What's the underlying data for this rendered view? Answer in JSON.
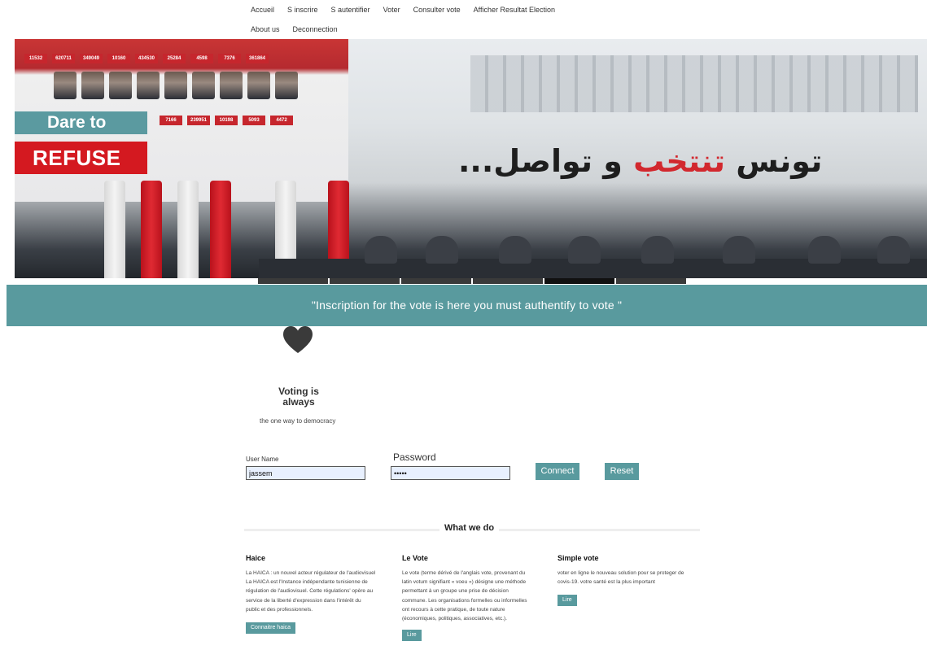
{
  "nav": {
    "row1": [
      "Accueil",
      "S inscrire",
      "S autentifier",
      "Voter",
      "Consulter vote",
      "Afficher Resultat Election"
    ],
    "row2": [
      "About us",
      "Deconnection"
    ]
  },
  "hero": {
    "dare": "Dare to",
    "refuse": "REFUSE",
    "arabic_black_left": "تونس ",
    "arabic_red": "تنتخب",
    "arabic_black_right": " و تواصل...",
    "vote_counts_top": [
      "11532",
      "620711",
      "349049",
      "10160",
      "434530",
      "25284",
      "4598",
      "7376",
      "361864"
    ],
    "vote_counts_bottom": [
      "7166",
      "239951",
      "10198",
      "5093",
      "4472"
    ]
  },
  "slider": {
    "count": 6,
    "active_index": 4
  },
  "banner": {
    "text": "\"Inscription for the vote is here you must authentify to vote \""
  },
  "tagline": {
    "title_line1": "Voting is",
    "title_line2": "always",
    "subtitle": "the one way to democracy"
  },
  "login": {
    "username_label": "User Name",
    "username_value": "jassem",
    "password_label": "Password",
    "password_value": "•••••",
    "connect_label": "Connect",
    "reset_label": "Reset"
  },
  "what_we_do": {
    "title": "What we do",
    "columns": [
      {
        "title": "Haice",
        "text": "La HAICA : un nouvel acteur régulateur de l'audiovisuel La HAICA est l'Instance indépendante tunisienne de régulation de l'audiovisuel. Cette régulations' opère au service de la liberté d'expression dans l'intérêt du public et des professionnels.",
        "button": "Connaitre haica"
      },
      {
        "title": "Le Vote",
        "text": "Le vote (terme dérivé de l'anglais vote, provenant du latin votum signifiant « voeu ») désigne une méthode permettant à un groupe une prise de décision commune. Les organisations formelles ou informelles ont recours à cette pratique, de toute nature (économiques, politiques, associatives, etc.).",
        "button": "Lire"
      },
      {
        "title": "Simple vote",
        "text": "voter en ligne le nouveau solution pour se proteger de covis-19. votre santé est la plus important",
        "button": "Lire"
      }
    ]
  },
  "colors": {
    "teal": "#599a9e",
    "red": "#d41920",
    "heart": "#3a3a3a"
  }
}
